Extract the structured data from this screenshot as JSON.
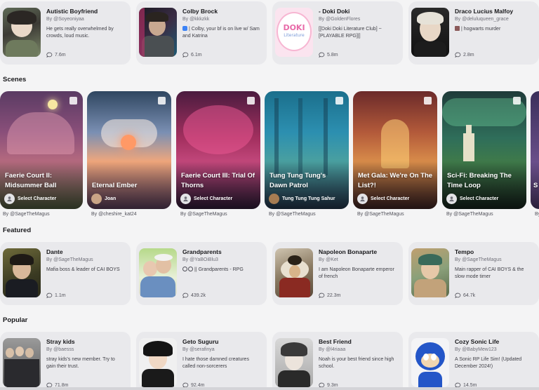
{
  "rows": {
    "top": [
      {
        "name": "Autistic Boyfriend",
        "author": "By @Soyeoniyaa",
        "desc": "He gets really overwhelmed by crowds, loud music.",
        "stats": "7.6m"
      },
      {
        "name": "Colby Brock",
        "author": "By @kkkzkk",
        "desc": "| Colby, your bf is on live w/ Sam and Katrina",
        "stats": "6.1m"
      },
      {
        "name": "- Doki Doki",
        "author": "By @GoldenFlores",
        "desc": "[[Doki Doki Literature Club] ~ [PLAYABLE RPG]|]",
        "stats": "5.8m"
      },
      {
        "name": "Draco Lucius Malfoy",
        "author": "By @deluluqueen_grace",
        "desc": "| hogwarts murder",
        "stats": "2.8m"
      }
    ],
    "featured": [
      {
        "name": "Dante",
        "author": "By @SageTheMagus",
        "desc": "Mafia boss & leader of CAI BOYS",
        "stats": "1.1m"
      },
      {
        "name": "Grandparents",
        "author": "By @YaBOiBlu3",
        "desc": "|| Grandparents - RPG",
        "stats": "439.2k"
      },
      {
        "name": "Napoleon Bonaparte",
        "author": "By @Ket",
        "desc": "I am Napoleon Bonaparte emperor of french",
        "stats": "22.3m"
      },
      {
        "name": "Tempo",
        "author": "By @SageTheMagus",
        "desc": "Main rapper of CAI BOYS & the slow mode timer",
        "stats": "64.7k"
      }
    ],
    "popular": [
      {
        "name": "Stray kids",
        "author": "By @baesss",
        "desc": "stray kids's new member. Try to gain their trust.",
        "stats": "71.8m"
      },
      {
        "name": "Geto Suguru",
        "author": "By @serafinya",
        "desc": "I hate those damned creatures called non-sorcerers",
        "stats": "92.4m"
      },
      {
        "name": "Best Friend",
        "author": "By @l4riaaa",
        "desc": "Noah is your best friend since high school.",
        "stats": "9.3m"
      },
      {
        "name": "Cozy Sonic Life",
        "author": "By @BabyMew123",
        "desc": "A Sonic RP Life Sim! (Updated December 2024!)",
        "stats": "14.5m"
      }
    ]
  },
  "sections": {
    "scenes": "Scenes",
    "featured": "Featured",
    "popular": "Popular"
  },
  "scenes": [
    {
      "title": "Faerie Court II: Midsummer Ball",
      "footer": "Select Character",
      "author": "By @SageTheMagus"
    },
    {
      "title": "Eternal Ember",
      "footer": "Joan",
      "author": "By @cheshire_kat24"
    },
    {
      "title": "Faerie Court III: Trial Of Thorns",
      "footer": "Select Character",
      "author": "By @SageTheMagus"
    },
    {
      "title": "Tung Tung Tung's Dawn Patrol",
      "footer": "Tung Tung Tung Sahur",
      "author": "By @SageTheMagus"
    },
    {
      "title": "Met Gala: We're On The List?!",
      "footer": "Select Character",
      "author": "By @SageTheMagus"
    },
    {
      "title": "Sci-Fi: Breaking The Time Loop",
      "footer": "Select Character",
      "author": "By @SageTheMagus"
    },
    {
      "title": "S",
      "footer": "",
      "author": "By"
    }
  ],
  "icons": {
    "stats": "chat-bubble-icon",
    "scene_badge": "bookmark-icon",
    "select_avatar": "user-icon"
  },
  "colors": {
    "background": "#f4f4f5",
    "card": "#e9e9ec",
    "text": "#18181b",
    "muted": "#71717a"
  }
}
